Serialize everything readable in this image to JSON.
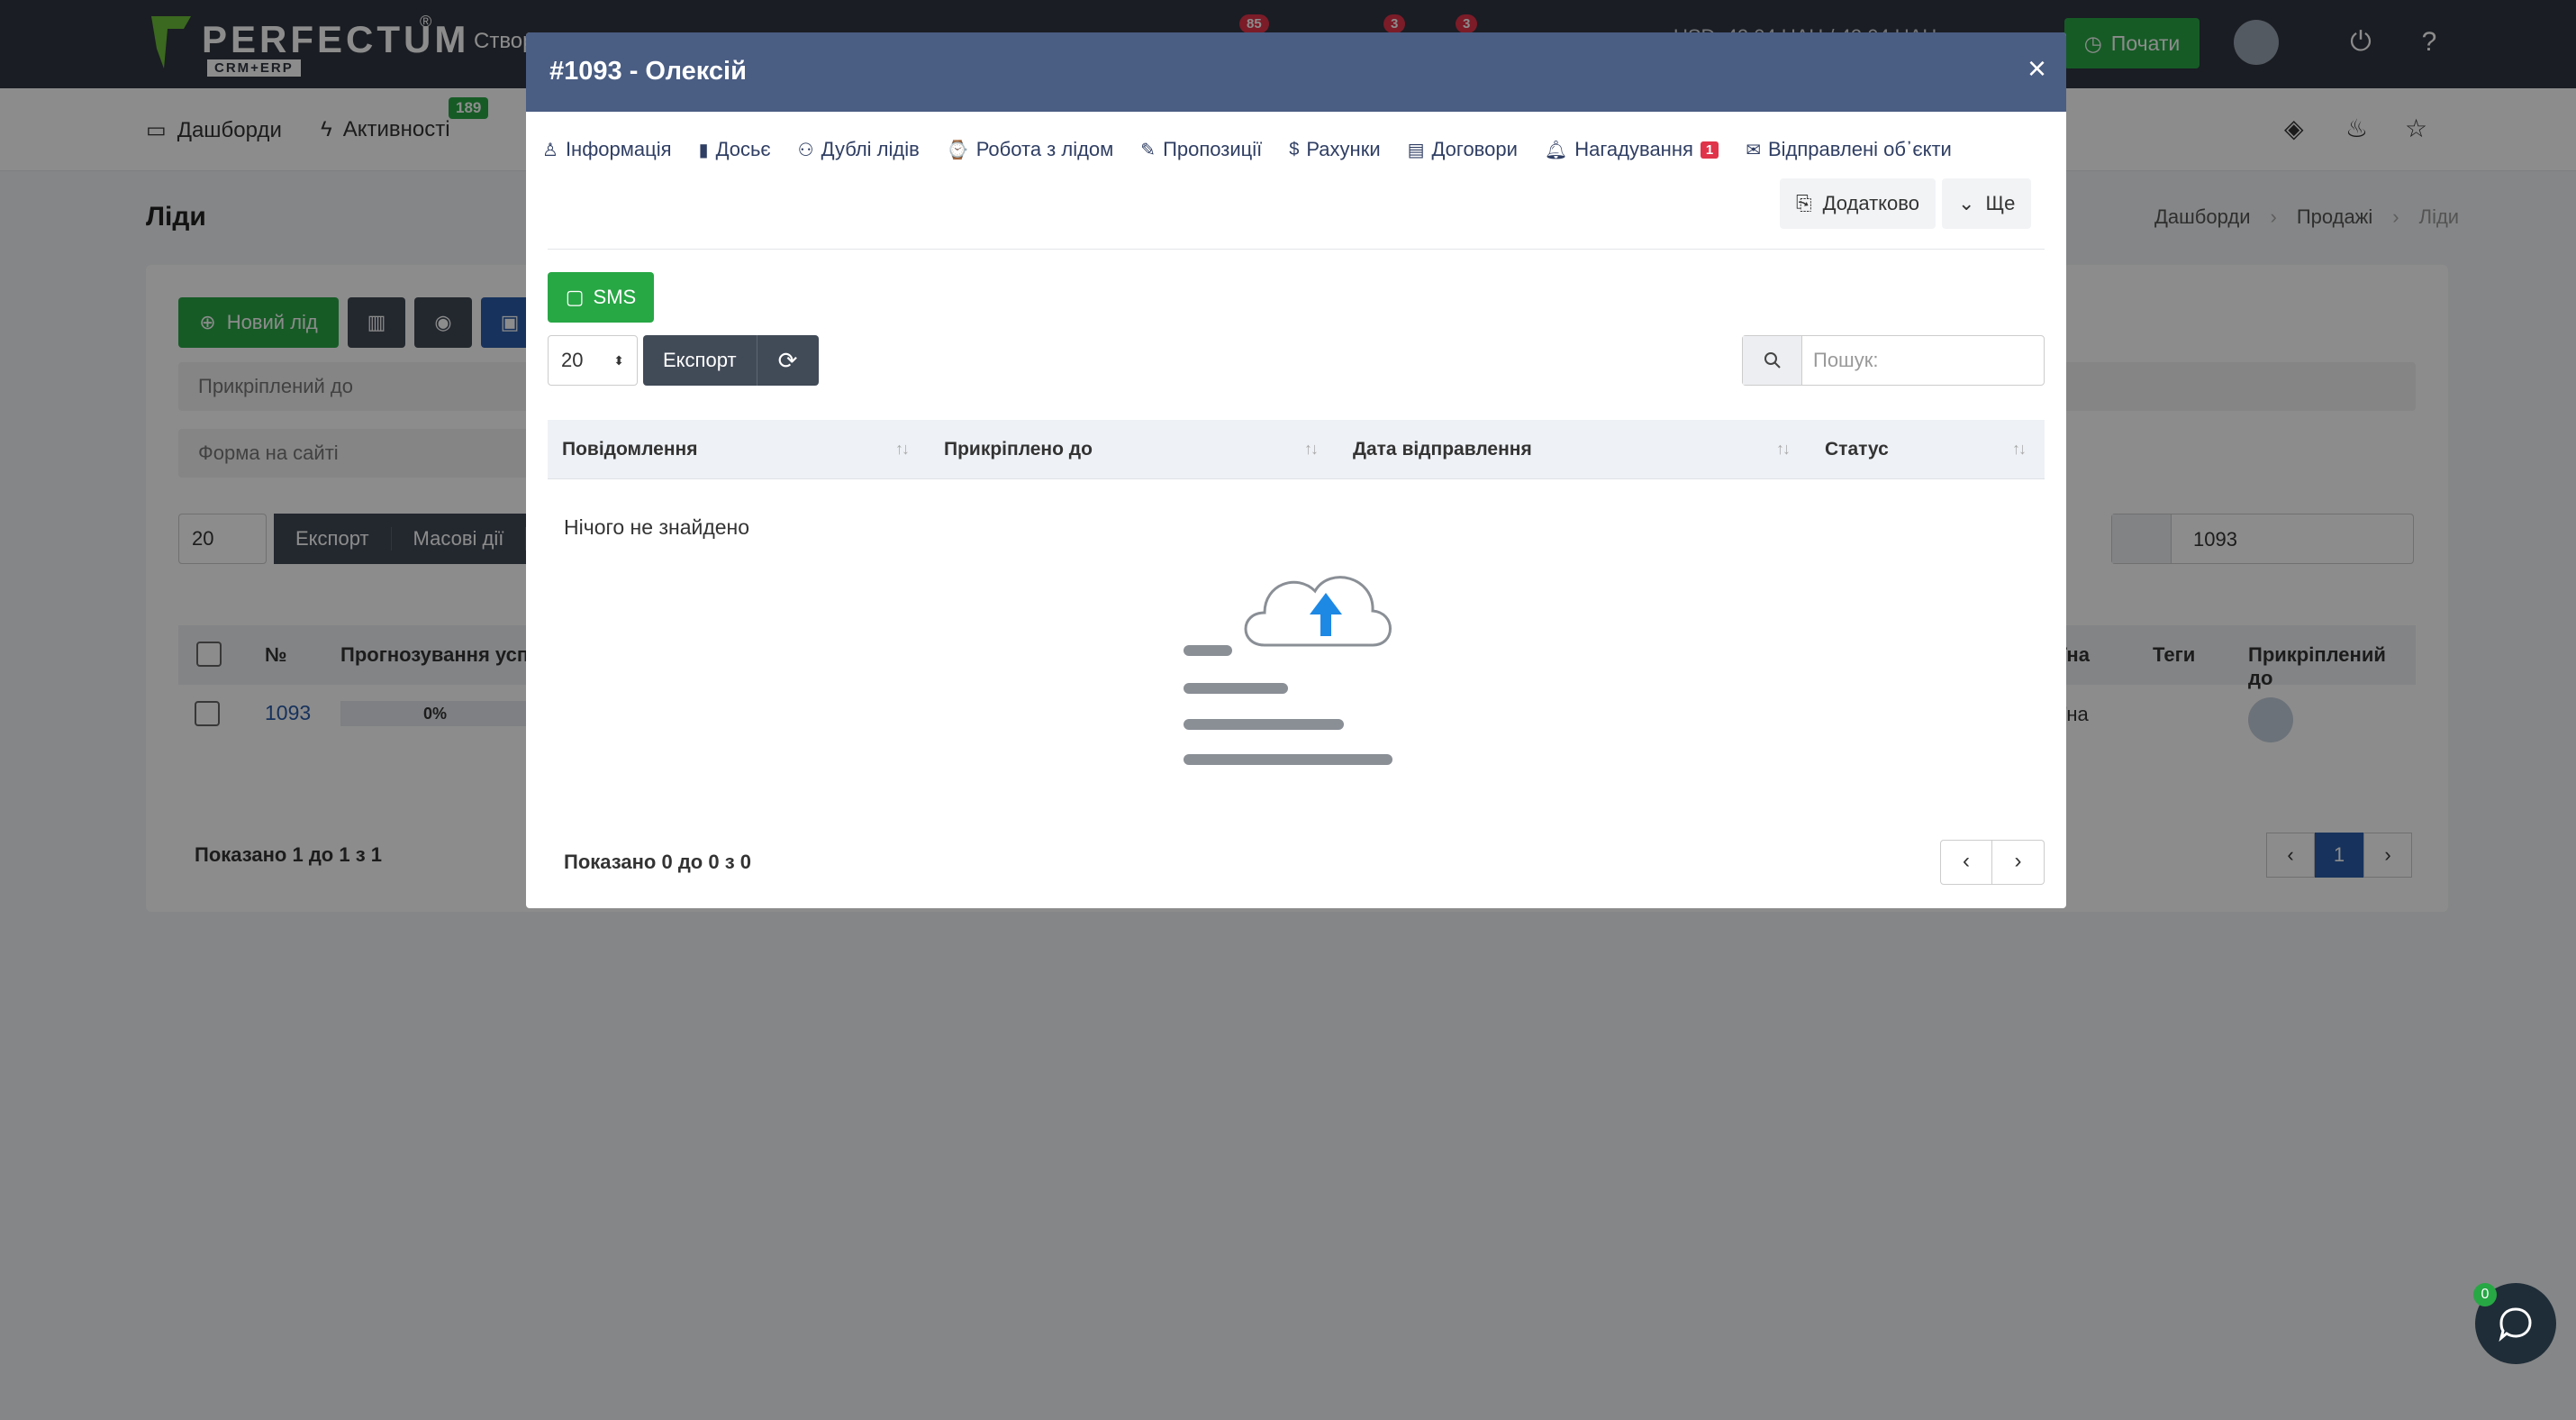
{
  "topbar": {
    "logo_text": "PERFECTUM",
    "logo_sub": "CRM+ERP",
    "logo_reg": "®",
    "create_label": "Створ",
    "badges": [
      "85",
      "3",
      "3"
    ],
    "rate": "USD: 42.04 UAH / 42.04 UAH",
    "start_label": "Почати"
  },
  "subnav": {
    "items": [
      "Дашборди",
      "Активності"
    ],
    "badge": "189"
  },
  "page": {
    "title": "Ліди",
    "breadcrumbs": [
      "Дашборди",
      "Продажі",
      "Ліди"
    ]
  },
  "leads_card": {
    "new_lead": "Новий лід",
    "filter_attached": "Прикріплений до",
    "filter_form": "Форма на сайті",
    "per_page": "20",
    "export": "Експорт",
    "mass_actions": "Масові дії",
    "search_value": "1093",
    "columns": [
      "№",
      "Прогнозування успіх",
      "аїна",
      "Теги",
      "Прикріплений до"
    ],
    "row": {
      "number": "1093",
      "forecast": "0%",
      "country": "аїна"
    },
    "shown": "Показано 1 до 1 з 1",
    "page": "1"
  },
  "modal": {
    "title": "#1093 - Олексій",
    "close": "×",
    "tabs": [
      {
        "label": "Інформація",
        "icon": "user-icon"
      },
      {
        "label": "Досьє",
        "icon": "book-icon"
      },
      {
        "label": "Дублі лідів",
        "icon": "users-icon"
      },
      {
        "label": "Робота з лідом",
        "icon": "watch-icon"
      },
      {
        "label": "Пропозиції",
        "icon": "pencil-icon"
      },
      {
        "label": "Рахунки",
        "icon": "dollar-icon"
      },
      {
        "label": "Договори",
        "icon": "document-icon"
      },
      {
        "label": "Нагадування",
        "icon": "bell-icon",
        "badge": "1"
      },
      {
        "label": "Відправлені об᾿єкти",
        "icon": "mail-icon"
      }
    ],
    "additional": "Додатково",
    "more": "Ще",
    "sms": "SMS",
    "per_page": "20",
    "export": "Експорт",
    "search_placeholder": "Пошук:",
    "columns": [
      "Повідомлення",
      "Прикріплено до",
      "Дата відправлення",
      "Статус"
    ],
    "empty": "Нічого не знайдено",
    "shown": "Показано 0 до 0 з 0",
    "prev": "‹",
    "next": "›"
  },
  "chat": {
    "badge": "0"
  },
  "colors": {
    "header": "#4a5d83",
    "green": "#28a745",
    "dark": "#414a57",
    "badge_red": "#e0344a",
    "link_blue": "#2a5ca8"
  }
}
